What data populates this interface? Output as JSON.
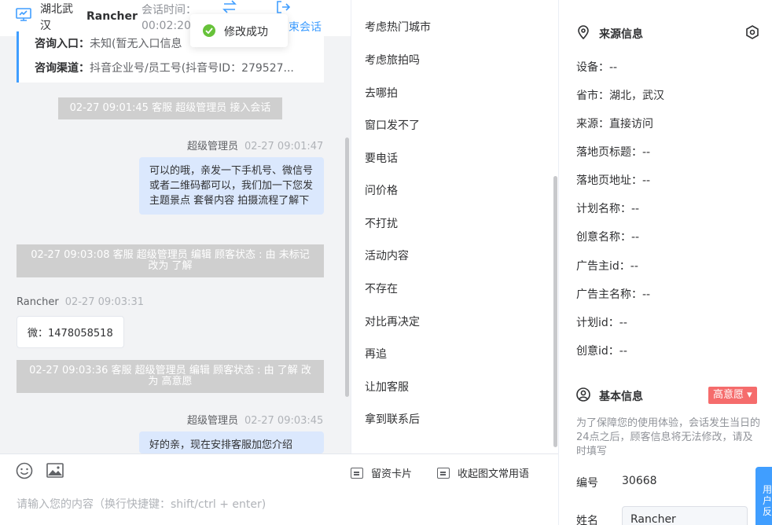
{
  "header": {
    "location": "湖北武汉",
    "customer_name": "Rancher",
    "session_time_label": "会话时间：",
    "session_time_value": "00:02:20",
    "end_session": "束会话"
  },
  "toast": {
    "text": "修改成功"
  },
  "info_card": {
    "entry_label": "咨询入口：",
    "entry_value": "未知(暂无入口信息",
    "channel_label": "咨询渠道：",
    "channel_value": "抖音企业号/员工号(抖音号ID：279527..."
  },
  "messages": [
    {
      "type": "system",
      "text": "02-27 09:01:45 客服 超级管理员 接入会话"
    },
    {
      "type": "outgoing",
      "sender": "超级管理员",
      "time": "02-27 09:01:47",
      "text": "可以的哦，亲发一下手机号、微信号或者二维码都可以，我们加一下您发主题景点 套餐内容 拍摄流程了解下"
    },
    {
      "type": "system",
      "text": "02-27 09:03:08 客服 超级管理员 编辑 顾客状态 : 由 未标记 改为 了解"
    },
    {
      "type": "incoming",
      "sender": "Rancher",
      "time": "02-27 09:03:31",
      "text": "微：1478058518"
    },
    {
      "type": "system",
      "text": "02-27 09:03:36 客服 超级管理员 编辑 顾客状态 : 由 了解 改为 高意愿"
    },
    {
      "type": "outgoing",
      "sender": "超级管理员",
      "time": "02-27 09:03:45",
      "text": "好的亲，现在安排客服加您介绍"
    }
  ],
  "input": {
    "placeholder": "请输入您的内容（换行快捷键：shift/ctrl + enter)",
    "card_button": "留资卡片",
    "collapse_button": "收起图文常用语"
  },
  "phrases": [
    "考虑热门城市",
    "考虑旅拍吗",
    "去哪拍",
    "窗口发不了",
    "要电话",
    "问价格",
    "不打扰",
    "活动内容",
    "不存在",
    "对比再决定",
    "再追",
    "让加客服",
    "拿到联系后"
  ],
  "source_info": {
    "title": "来源信息",
    "fields": [
      {
        "label": "设备：",
        "value": "--"
      },
      {
        "label": "省市：",
        "value": "湖北，武汉"
      },
      {
        "label": "来源：",
        "value": "直接访问"
      },
      {
        "label": "落地页标题：",
        "value": "--"
      },
      {
        "label": "落地页地址：",
        "value": "--"
      },
      {
        "label": "计划名称：",
        "value": "--"
      },
      {
        "label": "创意名称：",
        "value": "--"
      },
      {
        "label": "广告主id：",
        "value": "--"
      },
      {
        "label": "广告主名称：",
        "value": "--"
      },
      {
        "label": "计划id：",
        "value": "--"
      },
      {
        "label": "创意id：",
        "value": "--"
      }
    ]
  },
  "basic_info": {
    "title": "基本信息",
    "intent_badge": "高意愿 ▾",
    "notice": "为了保障您的使用体验，会话发生当日的24点之后，顾客信息将无法修改，请及时填写",
    "id_label": "编号",
    "id_value": "30668",
    "name_label": "姓名",
    "name_value": "Rancher"
  },
  "float_tab": {
    "label": "用户反"
  },
  "colors": {
    "accent": "#409eff",
    "success": "#67c23a",
    "danger": "#f56c6c",
    "bubble": "#dbe8fd",
    "system": "#cfcfcf"
  }
}
